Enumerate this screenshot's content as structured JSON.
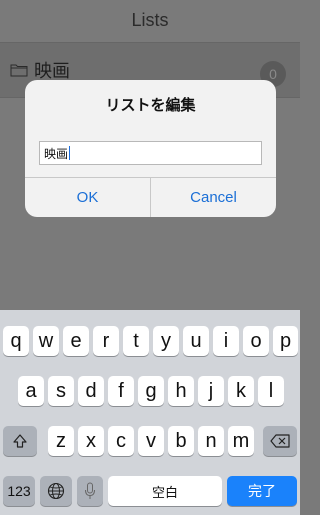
{
  "app": {
    "title": "Lists",
    "rows": [
      {
        "label": "映画",
        "count": "0"
      }
    ]
  },
  "alert": {
    "title": "リストを編集",
    "field_value": "映画",
    "ok_label": "OK",
    "cancel_label": "Cancel"
  },
  "keyboard": {
    "row1": [
      "q",
      "w",
      "e",
      "r",
      "t",
      "y",
      "u",
      "i",
      "o",
      "p"
    ],
    "row2": [
      "a",
      "s",
      "d",
      "f",
      "g",
      "h",
      "j",
      "k",
      "l"
    ],
    "row3": [
      "z",
      "x",
      "c",
      "v",
      "b",
      "n",
      "m"
    ],
    "numbers_label": "123",
    "space_label": "空白",
    "done_label": "完了",
    "icons": {
      "shift": "shift-arrow-icon",
      "delete": "delete-icon",
      "globe": "globe-icon",
      "mic": "microphone-icon"
    }
  },
  "colors": {
    "accent": "#1b6fd6",
    "done_key": "#1a82fb",
    "keyboard_bg": "#d1d4d9",
    "dim_overlay": "#7a7a7a"
  }
}
